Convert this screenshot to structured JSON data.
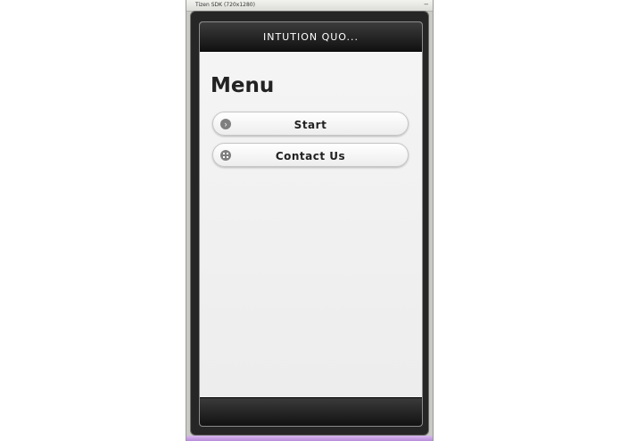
{
  "window": {
    "title": "Tizen SDK (720x1280)",
    "minimize_glyph": "–"
  },
  "app": {
    "header_title": "INTUTION QUO..."
  },
  "main": {
    "heading": "Menu",
    "buttons": [
      {
        "label": "Start",
        "icon": "arrow-right-circle-icon"
      },
      {
        "label": "Contact Us",
        "icon": "grid-icon"
      }
    ]
  },
  "colors": {
    "header_bg": "#1e1e1e",
    "content_bg": "#f2f2f2",
    "button_bg": "#ffffff",
    "accent_strip": "#c8a0e6"
  }
}
